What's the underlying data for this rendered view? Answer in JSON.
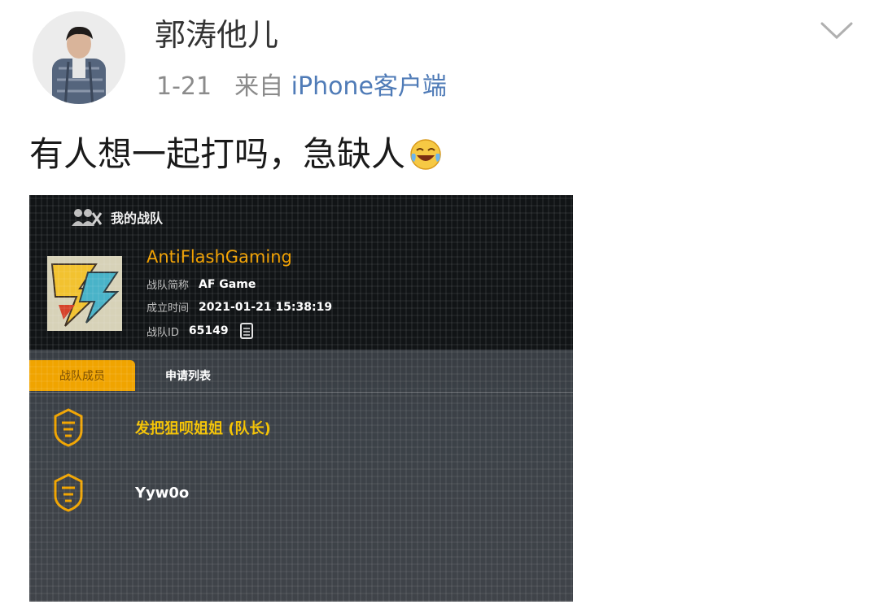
{
  "author": {
    "name": "郭涛他儿"
  },
  "meta": {
    "time": "1-21",
    "source_prefix": "来自",
    "source": "iPhone客户端"
  },
  "post": {
    "text": "有人想一起打吗，急缺人",
    "emoji": "laugh-cry-emoji"
  },
  "game": {
    "header_title": "我的战队",
    "team_name": "AntiFlashGaming",
    "info": [
      {
        "label": "战队简称",
        "value": "AF Game"
      },
      {
        "label": "成立时间",
        "value": "2021-01-21 15:38:19"
      },
      {
        "label": "战队ID",
        "value": "65149"
      }
    ],
    "tabs": [
      "战队成员",
      "申请列表"
    ],
    "members": [
      {
        "name": "发把狙呗姐姐 (队长)"
      },
      {
        "name": "Yyw0o"
      }
    ]
  },
  "colors": {
    "link": "#4f7bb7",
    "accent": "#f0a400"
  }
}
